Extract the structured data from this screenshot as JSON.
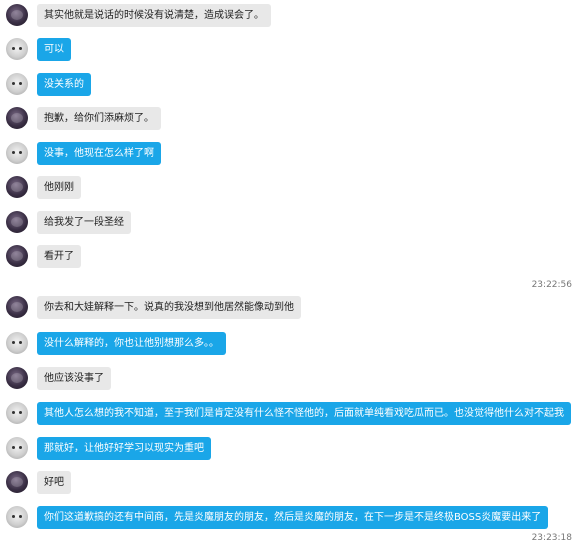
{
  "colors": {
    "me_bubble": "#1aa6e8",
    "other_bubble": "#e8e8e8"
  },
  "timestamps": [
    "23:22:56",
    "23:23:18"
  ],
  "messages": [
    {
      "sender": "other",
      "text": "其实他就是说话的时候没有说清楚，造成误会了。"
    },
    {
      "sender": "me",
      "text": "可以"
    },
    {
      "sender": "me",
      "text": "没关系的"
    },
    {
      "sender": "other",
      "text": "抱歉，给你们添麻烦了。"
    },
    {
      "sender": "me",
      "text": "没事，他现在怎么样了啊"
    },
    {
      "sender": "other",
      "text": "他刚刚"
    },
    {
      "sender": "other",
      "text": "给我发了一段圣经"
    },
    {
      "sender": "other",
      "text": "看开了"
    },
    {
      "sender": "other",
      "text": "你去和大娃解释一下。说真的我没想到他居然能像动到他"
    },
    {
      "sender": "me",
      "text": "没什么解释的，你也让他别想那么多。。"
    },
    {
      "sender": "other",
      "text": "他应该没事了"
    },
    {
      "sender": "me",
      "text": "其他人怎么想的我不知道，至于我们是肯定没有什么怪不怪他的，后面就单纯看戏吃瓜而已。也没觉得他什么对不起我"
    },
    {
      "sender": "me",
      "text": "那就好，让他好好学习以现实为重吧"
    },
    {
      "sender": "other",
      "text": "好吧"
    },
    {
      "sender": "me",
      "text": "你们这道歉搞的还有中间商，先是炎魔朋友的朋友，然后是炎魔的朋友，在下一步是不是终极BOSS炎魔要出来了"
    }
  ]
}
